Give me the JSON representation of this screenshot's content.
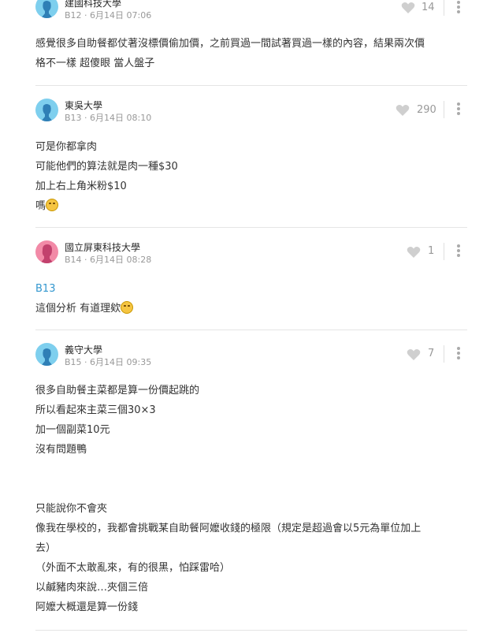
{
  "comments": [
    {
      "school": "建國科技大學",
      "floor": "B12",
      "time": "6月14日 07:06",
      "likes": "14",
      "avatar": "blue",
      "lines": [
        "感覺很多自助餐都仗著沒標價偷加價，之前買過一間試著買過一樣的內容，結果兩次價",
        "格不一樣 超傻眼 當人盤子"
      ]
    },
    {
      "school": "東吳大學",
      "floor": "B13",
      "time": "6月14日 08:10",
      "likes": "290",
      "avatar": "blue",
      "lines": [
        "可是你都拿肉",
        "可能他們的算法就是肉一種$30",
        "加上右上角米粉$10",
        "嗎"
      ],
      "emoji_name": "grinning-sweat-emoji"
    },
    {
      "school": "國立屏東科技大學",
      "floor": "B14",
      "time": "6月14日 08:28",
      "likes": "1",
      "avatar": "pink",
      "reply_to": "B13",
      "lines": [
        "這個分析 有道理欸"
      ],
      "emoji_name": "thinking-emoji"
    },
    {
      "school": "義守大學",
      "floor": "B15",
      "time": "6月14日 09:35",
      "likes": "7",
      "avatar": "blue",
      "lines": [
        "很多自助餐主菜都是算一份價起跳的",
        "所以看起來主菜三個30×3",
        "加一個副菜10元",
        "沒有問題鴨",
        "",
        "",
        "只能說你不會夾",
        "像我在學校的，我都會挑戰某自助餐阿嬤收錢的極限（規定是超過會以5元為單位加上",
        "去）",
        "（外面不太敢亂來，有的很黑，怕踩雷哈）",
        "以鹹豬肉來說…夾個三倍",
        "阿嬤大概還是算一份錢"
      ]
    }
  ],
  "separator": " · ",
  "colors": {
    "avatar_blue": "#7ecfee",
    "avatar_pink": "#f28aa7",
    "link": "#3397cf"
  },
  "icons": {
    "like": "heart-icon",
    "more": "more-vertical-icon"
  }
}
